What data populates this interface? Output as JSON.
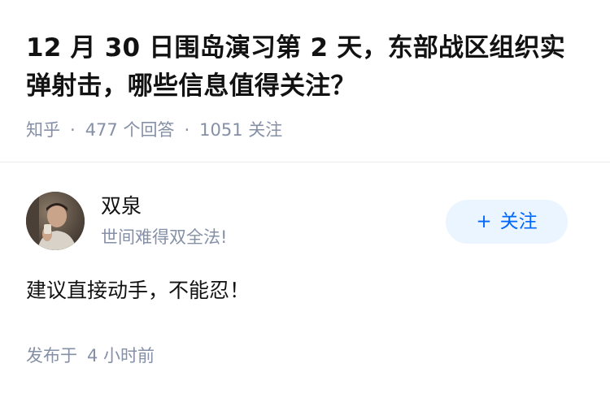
{
  "question": {
    "title": "12 月 30 日围岛演习第 2 天，东部战区组织实弹射击，哪些信息值得关注？",
    "source": "知乎",
    "separator": "·",
    "answer_count": "477 个回答",
    "follower_count": "1051 关注"
  },
  "answer": {
    "author": {
      "name": "双泉",
      "bio": "世间难得双全法!",
      "avatar_icon": "user-avatar-photo"
    },
    "follow_button": {
      "icon": "plus-icon",
      "label": "关注"
    },
    "content": "建议直接动手，不能忍！",
    "time_prefix": "发布于",
    "time_value": "4 小时前"
  },
  "colors": {
    "text_primary": "#121212",
    "text_secondary": "#8590a6",
    "accent": "#0066ff",
    "accent_background": "#ebf5ff",
    "divider": "#ebebeb"
  }
}
